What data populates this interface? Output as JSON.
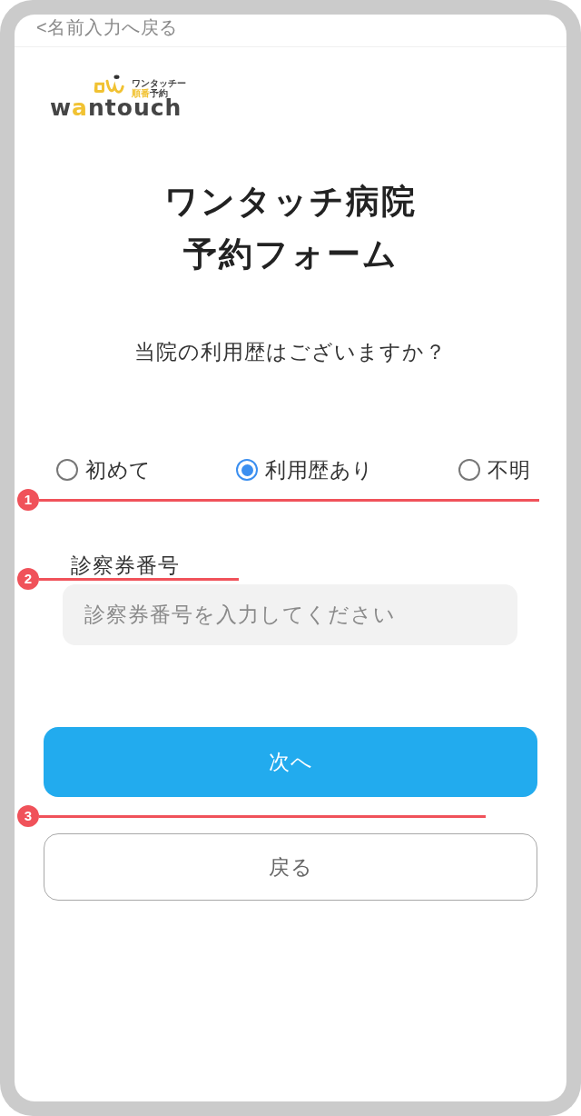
{
  "back_link": {
    "text": "<名前入力へ戻る"
  },
  "logo": {
    "tagline_top": "ワンタッチー",
    "tagline_bottom": [
      {
        "text": "順番",
        "accent": true
      },
      {
        "text": "予約",
        "accent": false
      }
    ],
    "wordmark": [
      {
        "text": "w",
        "accent": false
      },
      {
        "text": "a",
        "accent": true
      },
      {
        "text": "ntouch",
        "accent": false
      }
    ]
  },
  "title_lines": [
    "ワンタッチ病院",
    "予約フォーム"
  ],
  "question": "当院の利用歴はございますか？",
  "options": {
    "items": [
      {
        "label": "初めて",
        "selected": false
      },
      {
        "label": "利用歴あり",
        "selected": true
      },
      {
        "label": "不明",
        "selected": false
      }
    ],
    "marker": "1"
  },
  "card_number": {
    "label": "診察券番号",
    "placeholder": "診察券番号を入力してください",
    "marker": "2"
  },
  "buttons": {
    "next": "次へ",
    "marker": "3",
    "back": "戻る"
  }
}
